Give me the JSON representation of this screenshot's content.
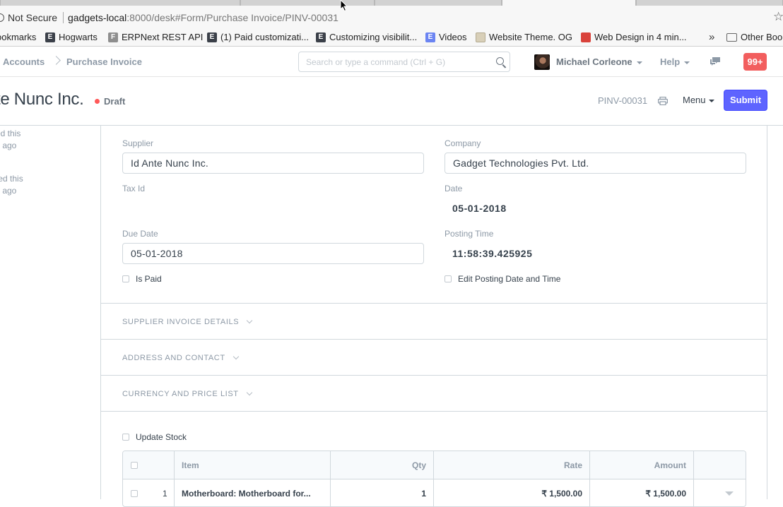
{
  "browser": {
    "security": "Not Secure",
    "url_host": "gadgets-local",
    "url_path": ":8000/desk#Form/Purchase Invoice/PINV-00031",
    "bookmarks": [
      {
        "label": "ookmarks",
        "favicon": "none"
      },
      {
        "label": "Hogwarts",
        "favicon": "E"
      },
      {
        "label": "ERPNext REST API",
        "favicon": "F"
      },
      {
        "label": "(1) Paid customizati...",
        "favicon": "E"
      },
      {
        "label": "Customizing visibilit...",
        "favicon": "E"
      },
      {
        "label": "Videos",
        "favicon": "E"
      },
      {
        "label": "Website Theme. OG",
        "favicon": "site"
      },
      {
        "label": "Web Design in 4 min...",
        "favicon": "red"
      }
    ],
    "overflow": "»",
    "other_bookmarks": "Other Book"
  },
  "navbar": {
    "breadcrumb": [
      "Accounts",
      "Purchase Invoice"
    ],
    "search_placeholder": "Search or type a command (Ctrl + G)",
    "user": "Michael Corleone",
    "help": "Help",
    "notifications": "99+"
  },
  "page": {
    "title": "te Nunc Inc.",
    "status": "Draft",
    "doc_name": "PINV-00031",
    "menu": "Menu",
    "submit": "Submit"
  },
  "timeline": [
    {
      "line1": "ed this",
      "line2": "s ago"
    },
    {
      "line1": "ted this",
      "line2": "s ago"
    }
  ],
  "form": {
    "supplier_label": "Supplier",
    "supplier": "Id Ante Nunc Inc.",
    "company_label": "Company",
    "company": "Gadget Technologies Pvt. Ltd.",
    "tax_id_label": "Tax Id",
    "date_label": "Date",
    "date": "05-01-2018",
    "due_date_label": "Due Date",
    "due_date": "05-01-2018",
    "posting_time_label": "Posting Time",
    "posting_time": "11:58:39.425925",
    "is_paid": "Is Paid",
    "edit_posting": "Edit Posting Date and Time",
    "sections": [
      "SUPPLIER INVOICE DETAILS",
      "ADDRESS AND CONTACT",
      "CURRENCY AND PRICE LIST"
    ],
    "update_stock": "Update Stock"
  },
  "items_table": {
    "columns": [
      "Item",
      "Qty",
      "Rate",
      "Amount"
    ],
    "rows": [
      {
        "idx": "1",
        "item": "Motherboard: Motherboard for...",
        "qty": "1",
        "rate": "₹ 1,500.00",
        "amount": "₹ 1,500.00"
      }
    ]
  },
  "colors": {
    "primary": "#5e64ff",
    "notification": "#f25e5e",
    "draft_dot": "#ff5858",
    "muted_text": "#8d99a6",
    "border": "#d1d8dd"
  }
}
